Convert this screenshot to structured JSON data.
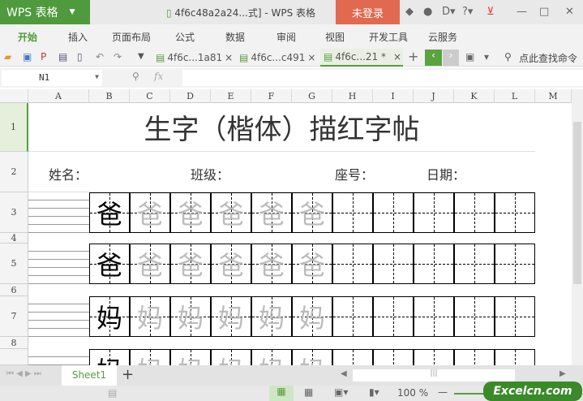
{
  "app": {
    "logo": "WPS 表格",
    "title": "4f6c48a2a24...式] - WPS 表格",
    "login": "未登录"
  },
  "menu": [
    "开始",
    "插入",
    "页面布局",
    "公式",
    "数据",
    "审阅",
    "视图",
    "开发工具",
    "云服务"
  ],
  "doc_tabs": [
    {
      "label": "4f6c...1a81"
    },
    {
      "label": "4f6c...c491"
    },
    {
      "label": "4f6c...21 *"
    }
  ],
  "search": "点此查找命令",
  "namebox": "N1",
  "fx": "fx",
  "columns": [
    "A",
    "B",
    "C",
    "D",
    "E",
    "F",
    "G",
    "H",
    "I",
    "J",
    "K",
    "L",
    "M"
  ],
  "rows": [
    "1",
    "2",
    "3",
    "4",
    "5",
    "6",
    "7",
    "8"
  ],
  "sheet": {
    "title": "生字（楷体）描红字帖",
    "name_label": "姓名：",
    "class_label": "班级：",
    "seat_label": "座号：",
    "date_label": "日期："
  },
  "practice": [
    {
      "char": "爸"
    },
    {
      "char": "爸"
    },
    {
      "char": "妈"
    },
    {
      "char": "妈"
    }
  ],
  "sheet_tab": "Sheet1",
  "zoom": "100 %",
  "watermark": "Excelcn.com",
  "colors": {
    "green": "#4f9a3c",
    "login": "#e0694f"
  }
}
